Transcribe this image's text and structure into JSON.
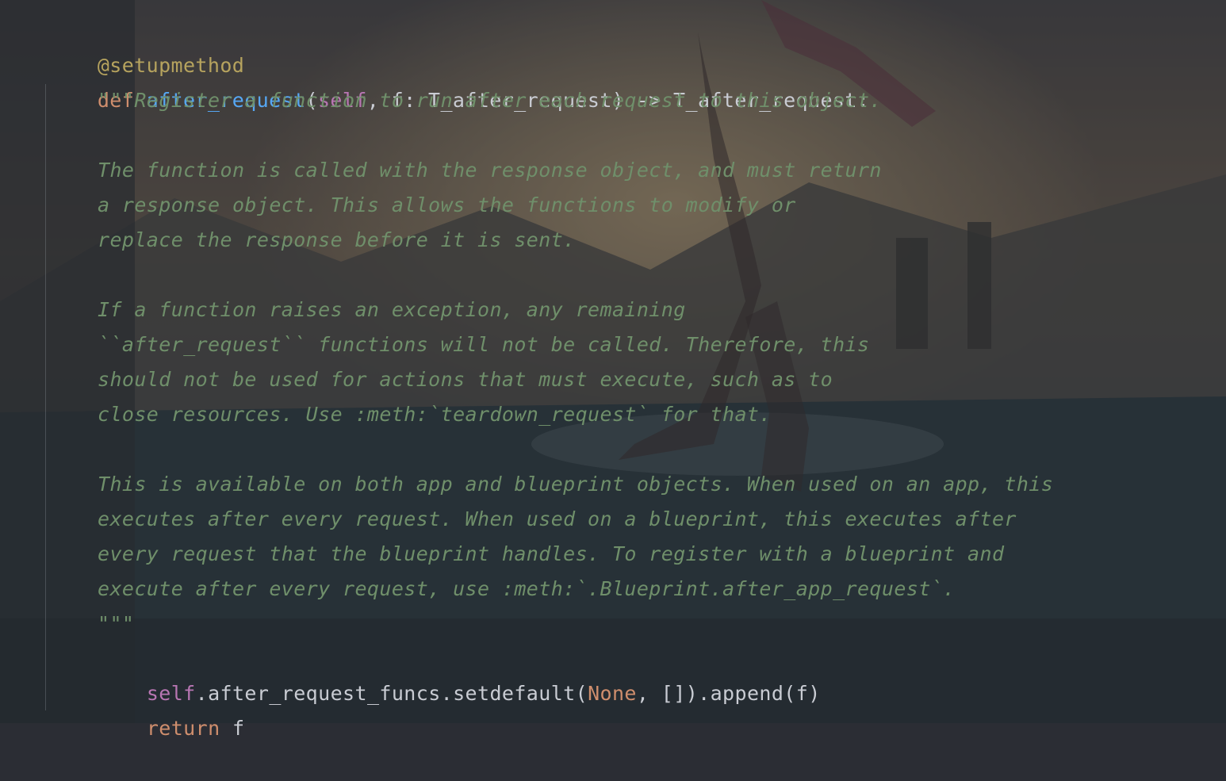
{
  "editor": {
    "decorator": "@setupmethod",
    "def_line": {
      "kw": "def",
      "fn_name": "after_request",
      "open": "(",
      "self": "self",
      "rest": ", f: T_after_request) -> T_after_request:"
    },
    "docstring_lines": [
      "\"\"\"Register a function to run after each request to this object.",
      "",
      "The function is called with the response object, and must return",
      "a response object. This allows the functions to modify or",
      "replace the response before it is sent.",
      "",
      "If a function raises an exception, any remaining",
      "``after_request`` functions will not be called. Therefore, this",
      "should not be used for actions that must execute, such as to",
      "close resources. Use :meth:`teardown_request` for that.",
      "",
      "This is available on both app and blueprint objects. When used on an app, this",
      "executes after every request. When used on a blueprint, this executes after",
      "every request that the blueprint handles. To register with a blueprint and",
      "execute after every request, use :meth:`.Blueprint.after_app_request`.",
      "\"\"\""
    ],
    "stmt_line": {
      "self": "self",
      "mid": ".after_request_funcs.setdefault(",
      "none": "None",
      "end": ", []).append(f)"
    },
    "return_line": {
      "kw": "return",
      "value": " f"
    }
  }
}
